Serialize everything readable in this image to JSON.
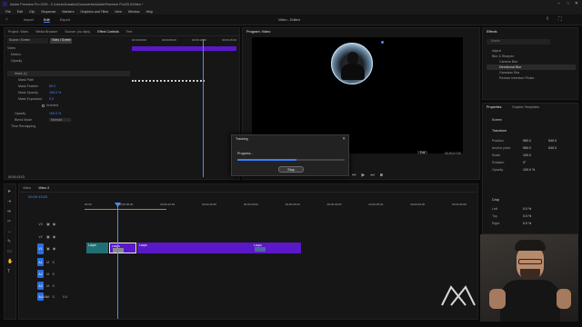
{
  "window": {
    "title": "Adobe Premiere Pro 2025 - C:\\Users\\Gosatko\\Documents\\Adobe\\Premiere Pro\\25.0\\Video *",
    "menu": [
      "File",
      "Edit",
      "Clip",
      "Sequence",
      "Markers",
      "Graphics and Titles",
      "View",
      "Window",
      "Help"
    ]
  },
  "workspaces": {
    "tabs": [
      "Import",
      "Edit",
      "Export"
    ],
    "active": "Edit",
    "center_title": "Video - Edited"
  },
  "effect_controls": {
    "tabs": [
      "Project: Video",
      "Media Browser",
      "Source: (no clips)",
      "Effect Controls",
      "Text"
    ],
    "active_tab": "Effect Controls",
    "clip_label": "Source • Screen",
    "target_label": "Video • Screen",
    "section": "Video",
    "rows": [
      {
        "label": "Motion",
        "value": ""
      },
      {
        "label": "Opacity",
        "value": ""
      },
      {
        "label": "Mask (1)",
        "value": ""
      },
      {
        "label": "Mask Path",
        "value": ""
      },
      {
        "label": "Mask Feather",
        "value": "50.0"
      },
      {
        "label": "Mask Opacity",
        "value": "100.0 %"
      },
      {
        "label": "Mask Expansion",
        "value": "0.0"
      },
      {
        "label": "",
        "value": "Inverted"
      },
      {
        "label": "Opacity",
        "value": "100.0 %"
      },
      {
        "label": "Blend Mode",
        "value": "Normal"
      },
      {
        "label": "Time Remapping",
        "value": ""
      }
    ],
    "ruler": [
      "00:00:00:00",
      "00:00:05:00",
      "00:00:10:00",
      "00:00:15:00"
    ],
    "timecode": "00:00:13:03"
  },
  "program": {
    "title": "Program: Video",
    "timecode": "00:00:13:03",
    "duration": "00:00:47:00",
    "fit": "Full"
  },
  "tracking_dialog": {
    "title": "Tracking",
    "status": "Progress...",
    "progress": 0.55,
    "stop_label": "Stop"
  },
  "effects_panel": {
    "title": "Effects",
    "search_placeholder": "Search",
    "items": [
      "Adjust",
      "Blur & Sharpen",
      "Camera Blur",
      "Directional Blur",
      "Gaussian Blur",
      "Reduce Interlace Flicker"
    ]
  },
  "properties": {
    "tabs": [
      "Properties",
      "Graphic Templates"
    ],
    "object": "Screen",
    "section_transform": "Transform",
    "fields": [
      {
        "label": "Position",
        "v1": "960.0",
        "v2": "540.0"
      },
      {
        "label": "Anchor point",
        "v1": "960.0",
        "v2": "540.0"
      },
      {
        "label": "Scale",
        "v1": "100.0",
        "v2": ""
      },
      {
        "label": "Rotation",
        "v1": "0°",
        "v2": ""
      },
      {
        "label": "Opacity",
        "v1": "100.0 %",
        "v2": ""
      }
    ],
    "section_crop": "Crop",
    "crop_fields": [
      {
        "label": "Left",
        "v1": "0.0 %"
      },
      {
        "label": "Top",
        "v1": "0.0 %"
      },
      {
        "label": "Right",
        "v1": "0.0 %"
      }
    ]
  },
  "timeline": {
    "tabs": [
      "Video",
      "Video 2"
    ],
    "timecode": "00:00:13:03",
    "ruler": [
      "00:00",
      "00:00:05:00",
      "00:00:10:00",
      "00:00:15:00",
      "00:00:20:00",
      "00:00:25:00",
      "00:00:30:00",
      "00:00:35:00",
      "00:00:40:00",
      "00:00:45:00"
    ],
    "video_tracks": [
      "V3",
      "V2",
      "V1"
    ],
    "audio_tracks": [
      "A1",
      "A2",
      "A3",
      "A4"
    ],
    "mix_label": "Mix",
    "mix_value": "0.0",
    "clips": [
      "Loops",
      "Loops",
      "Loops",
      "Loops"
    ],
    "colors": {
      "teal": "#1f6f73",
      "violet": "#5a18c8",
      "selected": "#c8c8c8",
      "playhead": "#4a8cff"
    }
  }
}
